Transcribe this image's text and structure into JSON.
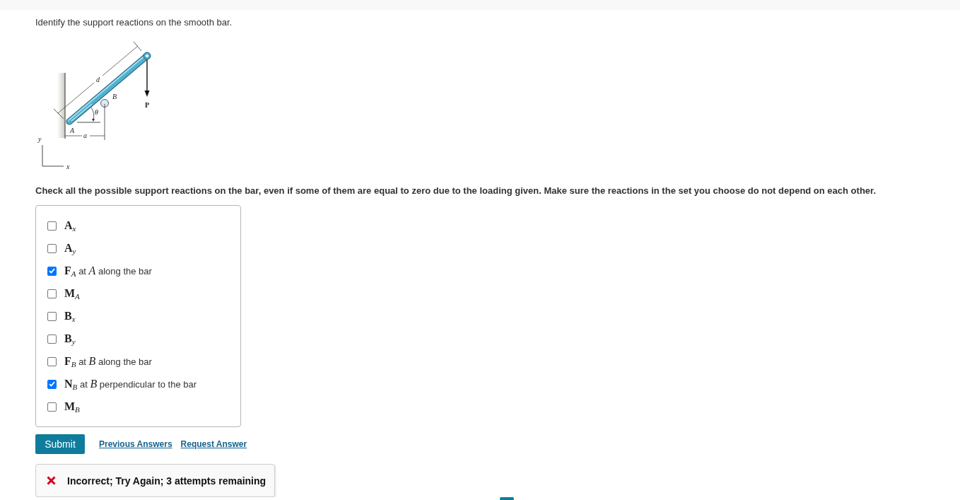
{
  "question": "Identify the support reactions on the smooth bar.",
  "figure": {
    "length_label": "d",
    "roller_label": "B",
    "load_label": "P",
    "angle_label": "θ",
    "pin_label": "A",
    "offset_label": "a",
    "y_axis_label": "y",
    "x_axis_label": "x"
  },
  "instruction": "Check all the possible support reactions on the bar, even if some of them are equal to zero due to the loading given. Make sure the reactions in the set you choose do not depend on each other.",
  "options": [
    {
      "label": "**A**$_{x}$",
      "checked": false
    },
    {
      "label": "**A**$_{y}$",
      "checked": false
    },
    {
      "label": "**F**$_{A}$ at *A* along the bar",
      "checked": true
    },
    {
      "label": "**M**$_{A}$",
      "checked": false
    },
    {
      "label": "**B**$_{x}$",
      "checked": false
    },
    {
      "label": "**B**$_{y}$",
      "checked": false
    },
    {
      "label": "**F**$_{B}$ at *B* along the bar",
      "checked": false
    },
    {
      "label": "**N**$_{B}$ at *B* perpendicular to the bar",
      "checked": true
    },
    {
      "label": "**M**$_{B}$",
      "checked": false
    }
  ],
  "actions": {
    "submit": "Submit",
    "links": [
      "Previous Answers",
      "Request Answer"
    ]
  },
  "feedback": {
    "correct": false,
    "message": "Incorrect; Try Again; 3 attempts remaining"
  }
}
